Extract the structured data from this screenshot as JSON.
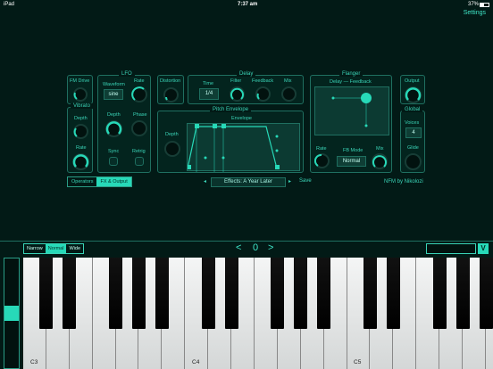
{
  "status": {
    "carrier": "iPad",
    "time": "7:37 am",
    "battery": "37%"
  },
  "header": {
    "settings": "Settings"
  },
  "fm_drive": {
    "label": "FM Drive"
  },
  "vibrato": {
    "title": "Vibrato",
    "depth": "Depth",
    "rate": "Rate"
  },
  "lfo": {
    "title": "LFO",
    "waveform": "Waveform",
    "waveform_value": "sine",
    "rate": "Rate",
    "depth": "Depth",
    "phase": "Phase",
    "sync": "Sync",
    "retrig": "Retrig"
  },
  "distortion": {
    "label": "Distortion"
  },
  "delay": {
    "title": "Delay",
    "time": "Time",
    "time_value": "1/4",
    "filter": "Filter",
    "feedback": "Feedback",
    "mix": "Mix"
  },
  "pitch_env": {
    "title": "Pitch Envelope",
    "envelope": "Envelope",
    "depth": "Depth"
  },
  "flanger": {
    "title": "Flanger",
    "axes": "Delay — Feedback",
    "rate": "Rate",
    "fb_mode": "FB Mode",
    "fb_mode_value": "Normal",
    "mix": "Mix"
  },
  "output": {
    "label": "Output"
  },
  "global": {
    "title": "Global",
    "voices": "Voices",
    "voices_value": "4",
    "glide": "Glide"
  },
  "tabs": [
    "Operators",
    "FX & Output"
  ],
  "preset": {
    "prev": "◂",
    "name": "Effects: A Year Later",
    "next": "▸",
    "save": "Save"
  },
  "credit": "NFM by Nikolozi",
  "keyboard": {
    "widths": [
      "Narrow",
      "Normal",
      "Wide"
    ],
    "octave_prev": "<",
    "octave": "0",
    "octave_next": ">",
    "notes": [
      "C3",
      "C4",
      "C5"
    ]
  },
  "colors": {
    "accent": "#27d9b8",
    "background": "#021a16",
    "panel_border": "#1f6f60"
  }
}
